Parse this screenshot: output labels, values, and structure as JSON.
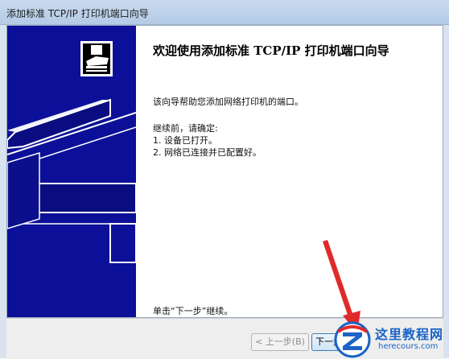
{
  "window": {
    "title": "添加标准 TCP/IP 打印机端口向导"
  },
  "wizard": {
    "heading": "欢迎使用添加标准 TCP/IP 打印机端口向导",
    "intro": "该向导帮助您添加网络打印机的端口。",
    "before_label": "继续前，请确定:",
    "steps": [
      "1.  设备已打开。",
      "2.  网络已连接并已配置好。"
    ],
    "footer_hint": "单击“下一步”继续。"
  },
  "buttons": {
    "back": "< 上一步(B)",
    "next": "下一步"
  },
  "banner": {
    "color": "#0c1098",
    "icon": "printer-icon"
  },
  "annotation": {
    "arrow_color": "#e02a2a",
    "icon": "red-arrow-icon"
  },
  "watermark": {
    "title": "这里教程网",
    "subtitle": "herecours.com",
    "logo": "z-logo-icon"
  }
}
